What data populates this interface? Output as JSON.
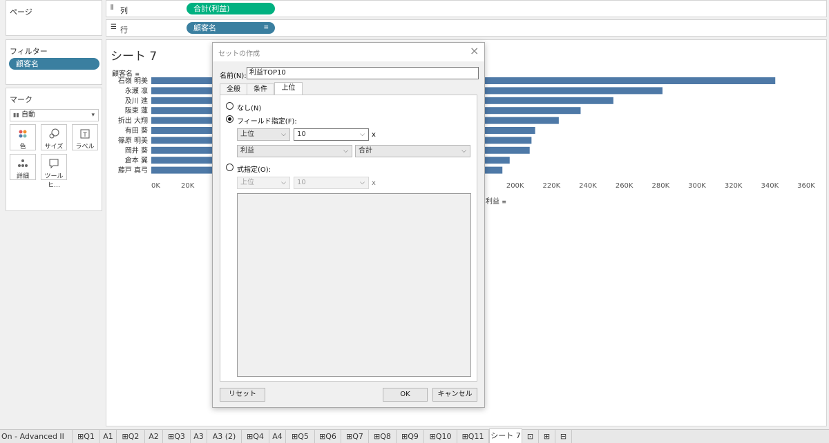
{
  "shelves": {
    "pages_title": "ページ",
    "columns_icon": "columns-icon",
    "columns_label": "列",
    "columns_pill": "合計(利益)",
    "rows_icon": "rows-icon",
    "rows_label": "行",
    "rows_pill": "顧客名"
  },
  "filters": {
    "title": "フィルター",
    "pill": "顧客名"
  },
  "marks": {
    "title": "マーク",
    "type_value": "自動",
    "buttons": [
      {
        "label": "色",
        "icon": "color-icon"
      },
      {
        "label": "サイズ",
        "icon": "size-icon"
      },
      {
        "label": "ラベル",
        "icon": "label-icon"
      },
      {
        "label": "詳細",
        "icon": "detail-icon"
      },
      {
        "label": "ツールヒ…",
        "icon": "tooltip-icon"
      }
    ]
  },
  "sheet": {
    "title": "シート 7",
    "row_header": "顧客名",
    "axis_title": "利益"
  },
  "chart_data": {
    "type": "bar",
    "orientation": "horizontal",
    "categories": [
      "石嶺 明美",
      "永瀬 凛",
      "及川 進",
      "阪東 蓮",
      "折出 大翔",
      "有田 葵",
      "篠原 明美",
      "岡井 葵",
      "倉本 翼",
      "藤戸 真弓"
    ],
    "values": [
      343000,
      281000,
      254000,
      236000,
      224000,
      211000,
      209000,
      208000,
      197000,
      193000
    ],
    "xlim": [
      0,
      360000
    ],
    "ticks": [
      {
        "v": 0,
        "label": "0K"
      },
      {
        "v": 20000,
        "label": "20K"
      },
      {
        "v": 200000,
        "label": "200K"
      },
      {
        "v": 220000,
        "label": "220K"
      },
      {
        "v": 240000,
        "label": "240K"
      },
      {
        "v": 260000,
        "label": "260K"
      },
      {
        "v": 280000,
        "label": "280K"
      },
      {
        "v": 300000,
        "label": "300K"
      },
      {
        "v": 320000,
        "label": "320K"
      },
      {
        "v": 340000,
        "label": "340K"
      },
      {
        "v": 360000,
        "label": "360K"
      }
    ],
    "bar_color": "#4e79a7"
  },
  "dialog": {
    "title": "セットの作成",
    "name_label": "名前(N):",
    "name_value": "利益TOP10",
    "tabs": [
      "全般",
      "条件",
      "上位"
    ],
    "radio_none": "なし(N)",
    "radio_field": "フィールド指定(F):",
    "field_dir": "上位",
    "field_count": "10",
    "by_label": "x",
    "field_name": "利益",
    "field_agg": "合計",
    "radio_formula": "式指定(O):",
    "formula_dir": "上位",
    "formula_count": "10",
    "formula_by": "x",
    "reset": "リセット",
    "ok": "OK",
    "cancel": "キャンセル"
  },
  "sheet_tabs": [
    "On - Advanced II",
    "Q1",
    "A1",
    "Q2",
    "A2",
    "Q3",
    "A3",
    "A3 (2)",
    "Q4",
    "A4",
    "Q5",
    "Q6",
    "Q7",
    "Q8",
    "Q9",
    "Q10",
    "Q11",
    "シート 7"
  ]
}
